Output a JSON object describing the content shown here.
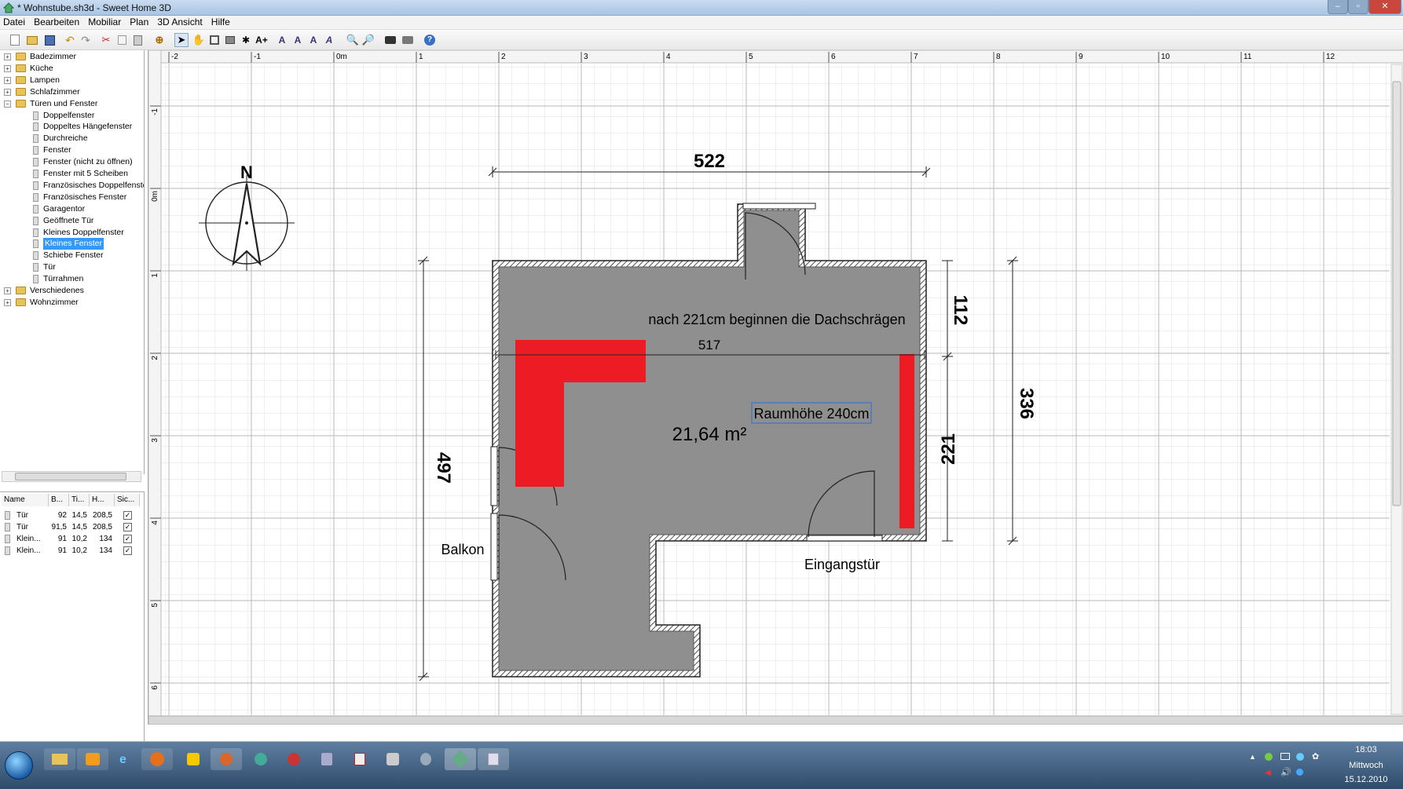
{
  "window": {
    "title": "* Wohnstube.sh3d - Sweet Home 3D"
  },
  "menu": [
    "Datei",
    "Bearbeiten",
    "Mobiliar",
    "Plan",
    "3D Ansicht",
    "Hilfe"
  ],
  "tree": {
    "items": [
      {
        "label": "Badezimmer",
        "type": "folder",
        "expanded": false
      },
      {
        "label": "Küche",
        "type": "folder",
        "expanded": false
      },
      {
        "label": "Lampen",
        "type": "folder",
        "expanded": false
      },
      {
        "label": "Schlafzimmer",
        "type": "folder",
        "expanded": false
      },
      {
        "label": "Türen und Fenster",
        "type": "folder",
        "expanded": true
      },
      {
        "label": "Doppelfenster",
        "type": "leaf"
      },
      {
        "label": "Doppeltes Hängefenster",
        "type": "leaf"
      },
      {
        "label": "Durchreiche",
        "type": "leaf"
      },
      {
        "label": "Fenster",
        "type": "leaf"
      },
      {
        "label": "Fenster (nicht zu öffnen)",
        "type": "leaf"
      },
      {
        "label": "Fenster mit 5 Scheiben",
        "type": "leaf"
      },
      {
        "label": "Französisches Doppelfenster",
        "type": "leaf"
      },
      {
        "label": "Französisches Fenster",
        "type": "leaf"
      },
      {
        "label": "Garagentor",
        "type": "leaf"
      },
      {
        "label": "Geöffnete Tür",
        "type": "leaf"
      },
      {
        "label": "Kleines Doppelfenster",
        "type": "leaf"
      },
      {
        "label": "Kleines Fenster",
        "type": "leaf",
        "selected": true
      },
      {
        "label": "Schiebe Fenster",
        "type": "leaf"
      },
      {
        "label": "Tür",
        "type": "leaf"
      },
      {
        "label": "Türrahmen",
        "type": "leaf"
      },
      {
        "label": "Verschiedenes",
        "type": "folder",
        "expanded": false
      },
      {
        "label": "Wohnzimmer",
        "type": "folder",
        "expanded": false
      }
    ]
  },
  "furniture_table": {
    "headers": [
      "Name",
      "B...",
      "Ti...",
      "H...",
      "Sic..."
    ],
    "rows": [
      {
        "name": "Tür",
        "b": "92",
        "t": "14,5",
        "h": "208,5",
        "visible": true
      },
      {
        "name": "Tür",
        "b": "91,5",
        "t": "14,5",
        "h": "208,5",
        "visible": true
      },
      {
        "name": "Klein...",
        "b": "91",
        "t": "10,2",
        "h": "134",
        "visible": true
      },
      {
        "name": "Klein...",
        "b": "91",
        "t": "10,2",
        "h": "134",
        "visible": true
      }
    ]
  },
  "ruler": {
    "x_ticks": [
      "-2",
      "-1",
      "0m",
      "1",
      "2",
      "3",
      "4",
      "5",
      "6",
      "7",
      "8",
      "9",
      "10",
      "11",
      "12"
    ],
    "y_ticks": [
      "-1",
      "0m",
      "1",
      "2",
      "3",
      "4",
      "5",
      "6"
    ]
  },
  "plan": {
    "compass_label": "N",
    "dims": {
      "top": "522",
      "inner": "517",
      "left": "497",
      "right_upper": "112",
      "right_lower": "221",
      "right_total": "336"
    },
    "labels": {
      "note": "nach 221cm beginnen die Dachschrägen",
      "room_height": "Raumhöhe 240cm",
      "area": "21,64 m²",
      "balcony": "Balkon",
      "entrance": "Eingangstür"
    },
    "colors": {
      "furniture": "#ed1c24",
      "room": "#8f8f8f"
    }
  },
  "taskbar": {
    "time": "18:03",
    "day": "Mittwoch",
    "date": "15.12.2010"
  }
}
